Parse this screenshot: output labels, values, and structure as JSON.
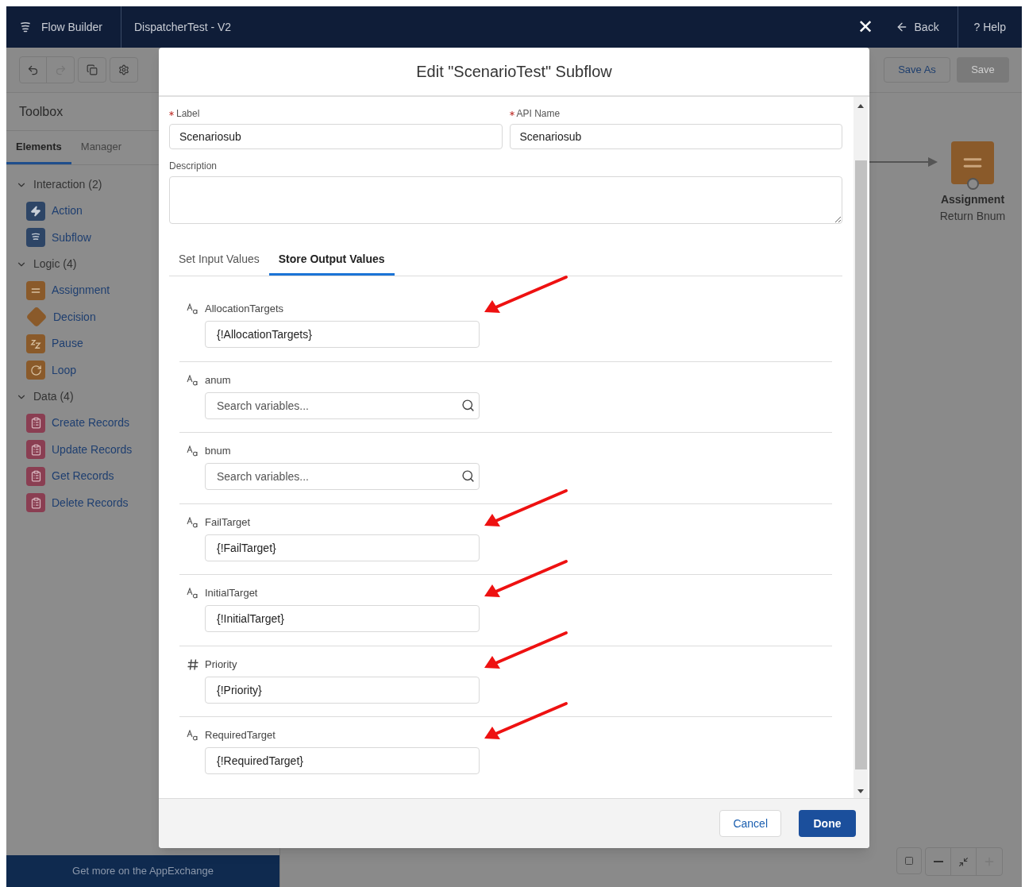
{
  "header": {
    "app_name": "Flow Builder",
    "flow_name": "DispatcherTest - V2",
    "close": "✕",
    "back": "Back",
    "help_mark": "?",
    "help": "Help"
  },
  "toolbar": {
    "save_as": "Save As",
    "save": {
      "label": "Save",
      "disabled": true
    }
  },
  "toolbox": {
    "title": "Toolbox",
    "tabs": [
      {
        "label": "Elements",
        "selected": true
      },
      {
        "label": "Manager",
        "selected": false
      }
    ],
    "sections": [
      {
        "label": "Interaction (2)",
        "expanded": true,
        "items": [
          {
            "label": "Action",
            "kind": "action"
          },
          {
            "label": "Subflow",
            "kind": "subflow"
          }
        ]
      },
      {
        "label": "Logic (4)",
        "expanded": true,
        "items": [
          {
            "label": "Assignment",
            "kind": "assignment"
          },
          {
            "label": "Decision",
            "kind": "decision"
          },
          {
            "label": "Pause",
            "kind": "pause"
          },
          {
            "label": "Loop",
            "kind": "loop"
          }
        ]
      },
      {
        "label": "Data (4)",
        "expanded": true,
        "items": [
          {
            "label": "Create Records",
            "kind": "record"
          },
          {
            "label": "Update Records",
            "kind": "record"
          },
          {
            "label": "Get Records",
            "kind": "record"
          },
          {
            "label": "Delete Records",
            "kind": "record"
          }
        ]
      }
    ],
    "footer": "Get more on the AppExchange"
  },
  "canvas": {
    "node": {
      "title": "Assignment",
      "subtitle": "Return Bnum"
    }
  },
  "modal": {
    "title": "Edit \"ScenarioTest\" Subflow",
    "label": {
      "label": "Label",
      "value": "Scenariosub",
      "required": true
    },
    "api_name": {
      "label": "API Name",
      "value": "Scenariosub",
      "required": true
    },
    "description": {
      "label": "Description"
    },
    "tabs": [
      {
        "label": "Set Input Values",
        "selected": false
      },
      {
        "label": "Store Output Values",
        "selected": true
      }
    ],
    "outputs": [
      {
        "name": "AllocationTargets",
        "kind": "text",
        "value": "{!AllocationTargets}",
        "annotated": true
      },
      {
        "name": "anum",
        "kind": "text",
        "placeholder": "Search variables...",
        "annotated": false
      },
      {
        "name": "bnum",
        "kind": "text",
        "placeholder": "Search variables...",
        "annotated": false
      },
      {
        "name": "FailTarget",
        "kind": "text",
        "value": "{!FailTarget}",
        "annotated": true
      },
      {
        "name": "InitialTarget",
        "kind": "text",
        "value": "{!InitialTarget}",
        "annotated": true
      },
      {
        "name": "Priority",
        "kind": "number",
        "value": "{!Priority}",
        "annotated": true
      },
      {
        "name": "RequiredTarget",
        "kind": "text",
        "value": "{!RequiredTarget}",
        "annotated": true
      }
    ],
    "buttons": {
      "cancel": "Cancel",
      "done": "Done"
    }
  }
}
